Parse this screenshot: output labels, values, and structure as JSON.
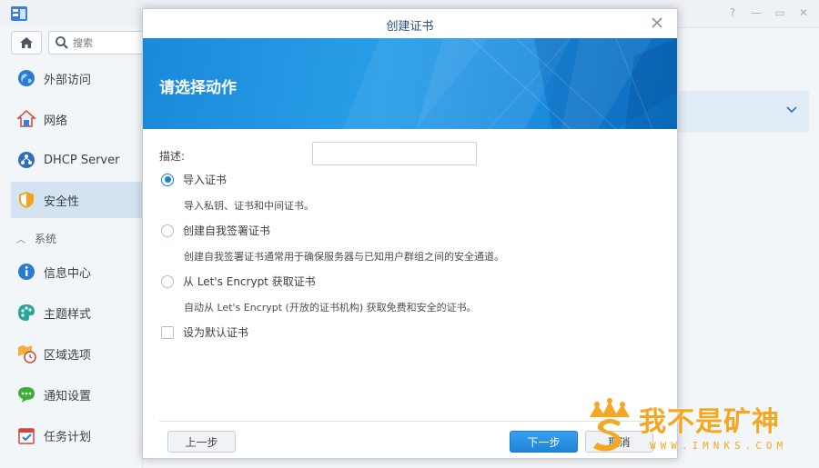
{
  "search": {
    "placeholder": "搜索"
  },
  "sidebar": {
    "items": [
      {
        "label": "外部访问",
        "icon": "globe-icon"
      },
      {
        "label": "网络",
        "icon": "network-house-icon"
      },
      {
        "label": "DHCP Server",
        "icon": "dhcp-icon"
      },
      {
        "label": "安全性",
        "icon": "shield-icon",
        "active": true
      }
    ],
    "section_label": "系统",
    "system_items": [
      {
        "label": "信息中心",
        "icon": "info-icon"
      },
      {
        "label": "主题样式",
        "icon": "palette-icon"
      },
      {
        "label": "区域选项",
        "icon": "region-clock-icon"
      },
      {
        "label": "通知设置",
        "icon": "chat-bubble-icon"
      },
      {
        "label": "任务计划",
        "icon": "calendar-check-icon"
      }
    ]
  },
  "dialog": {
    "title": "创建证书",
    "banner_title": "请选择动作",
    "description_label": "描述:",
    "description_value": "",
    "options": [
      {
        "label": "导入证书",
        "desc": "导入私钥、证书和中间证书。",
        "checked": true
      },
      {
        "label": "创建自我签署证书",
        "desc": "创建自我签署证书通常用于确保服务器与已知用户群组之间的安全通道。",
        "checked": false
      },
      {
        "label": "从 Let's Encrypt 获取证书",
        "desc": "自动从 Let's Encrypt (开放的证书机构) 获取免费和安全的证书。",
        "checked": false
      }
    ],
    "default_checkbox_label": "设为默认证书",
    "buttons": {
      "prev": "上一步",
      "next": "下一步",
      "cancel": "取消"
    }
  },
  "watermark": {
    "text": "我不是矿神",
    "url": "WWW.IMNKS.COM"
  },
  "colors": {
    "accent": "#1b7fd6",
    "banner": "#1f8fe0",
    "sidebar_active": "#d4e3f2",
    "watermark": "#f5a623"
  }
}
